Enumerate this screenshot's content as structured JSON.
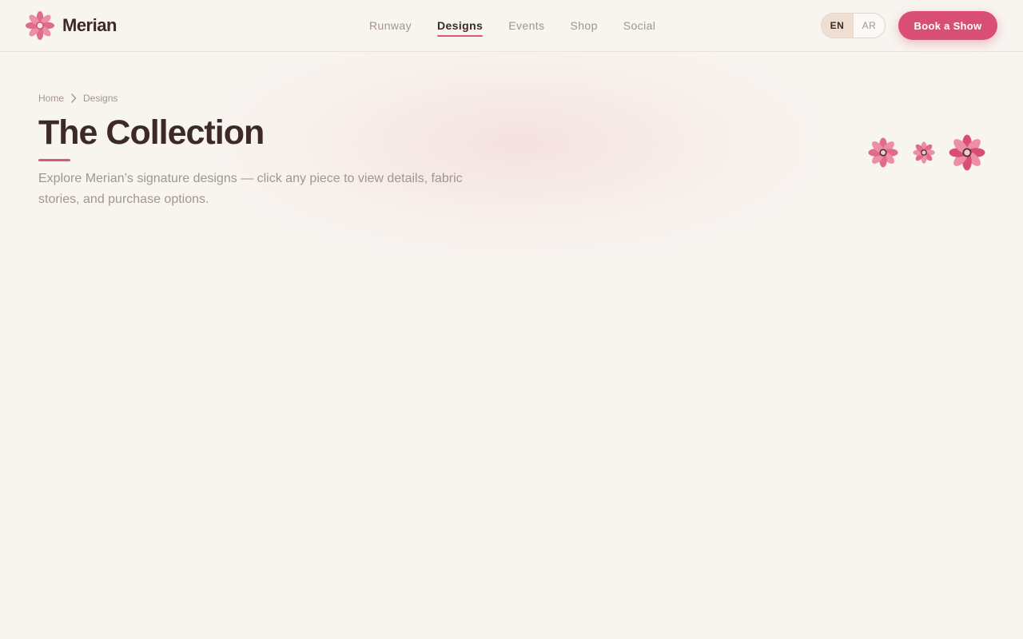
{
  "brand": {
    "name": "Merian"
  },
  "nav": {
    "items": [
      {
        "label": "Runway",
        "active": false
      },
      {
        "label": "Designs",
        "active": true
      },
      {
        "label": "Events",
        "active": false
      },
      {
        "label": "Shop",
        "active": false
      },
      {
        "label": "Social",
        "active": false
      }
    ]
  },
  "language": {
    "options": [
      "EN",
      "AR"
    ],
    "selected": "EN"
  },
  "cta": {
    "label": "Book a Show"
  },
  "breadcrumb": {
    "home": "Home",
    "current": "Designs"
  },
  "page": {
    "title": "The Collection",
    "subtitle": "Explore Merian’s signature designs — click any piece to view details, fabric stories, and purchase options."
  },
  "colors": {
    "accent": "#d94f73",
    "background": "#f8f4f0",
    "text": "#3d2a28",
    "muted": "#a3958d"
  },
  "icons": {
    "logo": "flower-icon",
    "breadcrumb_separator": "chevron-right-icon",
    "decoration": "flower-icon"
  }
}
